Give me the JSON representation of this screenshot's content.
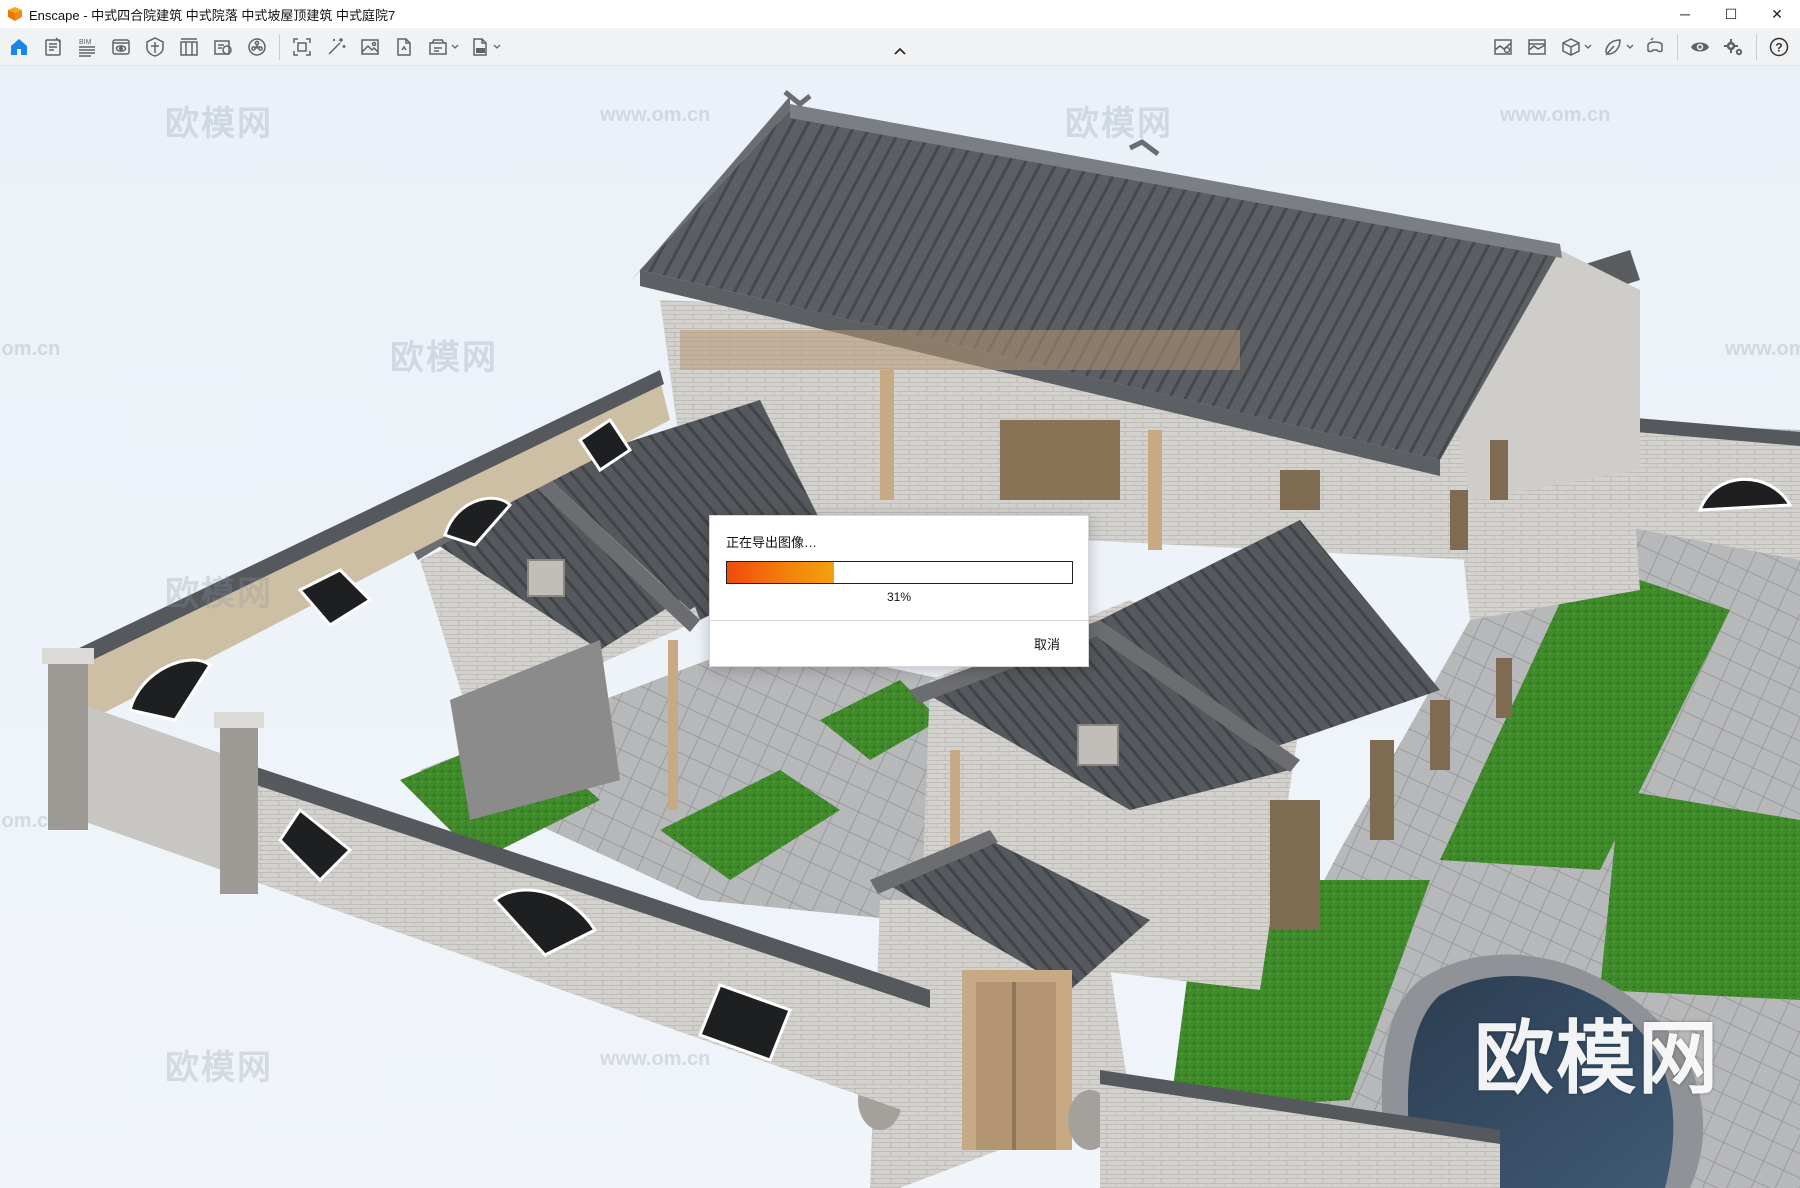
{
  "window": {
    "title": "Enscape - 中式四合院建筑 中式院落 中式坡屋顶建筑 中式庭院7",
    "minimize": "─",
    "maximize": "☐",
    "close": "✕"
  },
  "toolbar": {
    "left_icons": [
      "home-icon",
      "notes-icon",
      "bim-icon",
      "views-icon",
      "visual-settings-icon",
      "layers-icon",
      "view-management-icon",
      "asset-library-icon",
      "render-region-icon",
      "magic-wand-icon",
      "render-image-icon",
      "export-icon",
      "batch-render-icon",
      "export-file-icon"
    ],
    "bim_label": "BIM",
    "right_icons": [
      "map-icon",
      "panorama-icon",
      "cube-icon",
      "material-icon",
      "vr-headset-icon",
      "eye-icon",
      "settings-icon",
      "help-icon"
    ],
    "help_label": "?"
  },
  "viewport": {
    "watermark_text": "欧模网",
    "watermark_url": "www.om.cn",
    "watermark_large": "欧模网"
  },
  "export_dialog": {
    "title": "正在导出图像…",
    "progress_percent": 31,
    "progress_label": "31%",
    "cancel_label": "取消"
  },
  "colors": {
    "accent_blue": "#1a84e8",
    "progress_start": "#f04b0c",
    "progress_end": "#f3a10d",
    "logo_orange": "#f08a10",
    "roof_tile": "#55585c",
    "wall_brick": "#cdcbc7",
    "lawn": "#3f8a2a"
  }
}
